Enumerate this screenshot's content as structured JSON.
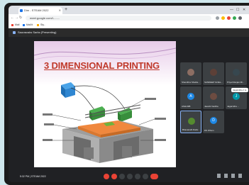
{
  "browser": {
    "tab_title": "Dim - STEAM 2022",
    "url": "meet.google.com/l-...-...",
    "bookmarks": [
      "Mail",
      "Mail.tt",
      "Sty.."
    ]
  },
  "meet": {
    "presenting_label": "Saurasraks Sarks (Presenting)",
    "meeting_info": "5:32 PM | STEAM 2022"
  },
  "slide": {
    "title": "3 DIMENSIONAL PRINTING"
  },
  "participants": [
    {
      "name": "Shandhra Shukla...",
      "avatar_color": "#8d6e63",
      "letter": ""
    },
    {
      "name": "SANDEEP GOEL...",
      "avatar_color": "#5d4037",
      "letter": ""
    },
    {
      "name": "Priyal Ranjan Mi...",
      "avatar_color": "#37474f",
      "letter": ""
    },
    {
      "name": "ASHLMB",
      "avatar_color": "#1e88e5",
      "letter": "A"
    },
    {
      "name": "Jawahi Vardha",
      "avatar_color": "#6d4c41",
      "letter": ""
    },
    {
      "name": "Jagarvitha ...",
      "avatar_color": "#0097a7",
      "letter": "J"
    },
    {
      "name": "Bhavanath Dattu",
      "avatar_color": "#558b2f",
      "letter": ""
    },
    {
      "name": "DS Whom",
      "avatar_color": "#1e88e5",
      "letter": "D"
    }
  ],
  "caption_flash": "Jagarvitha J is..."
}
